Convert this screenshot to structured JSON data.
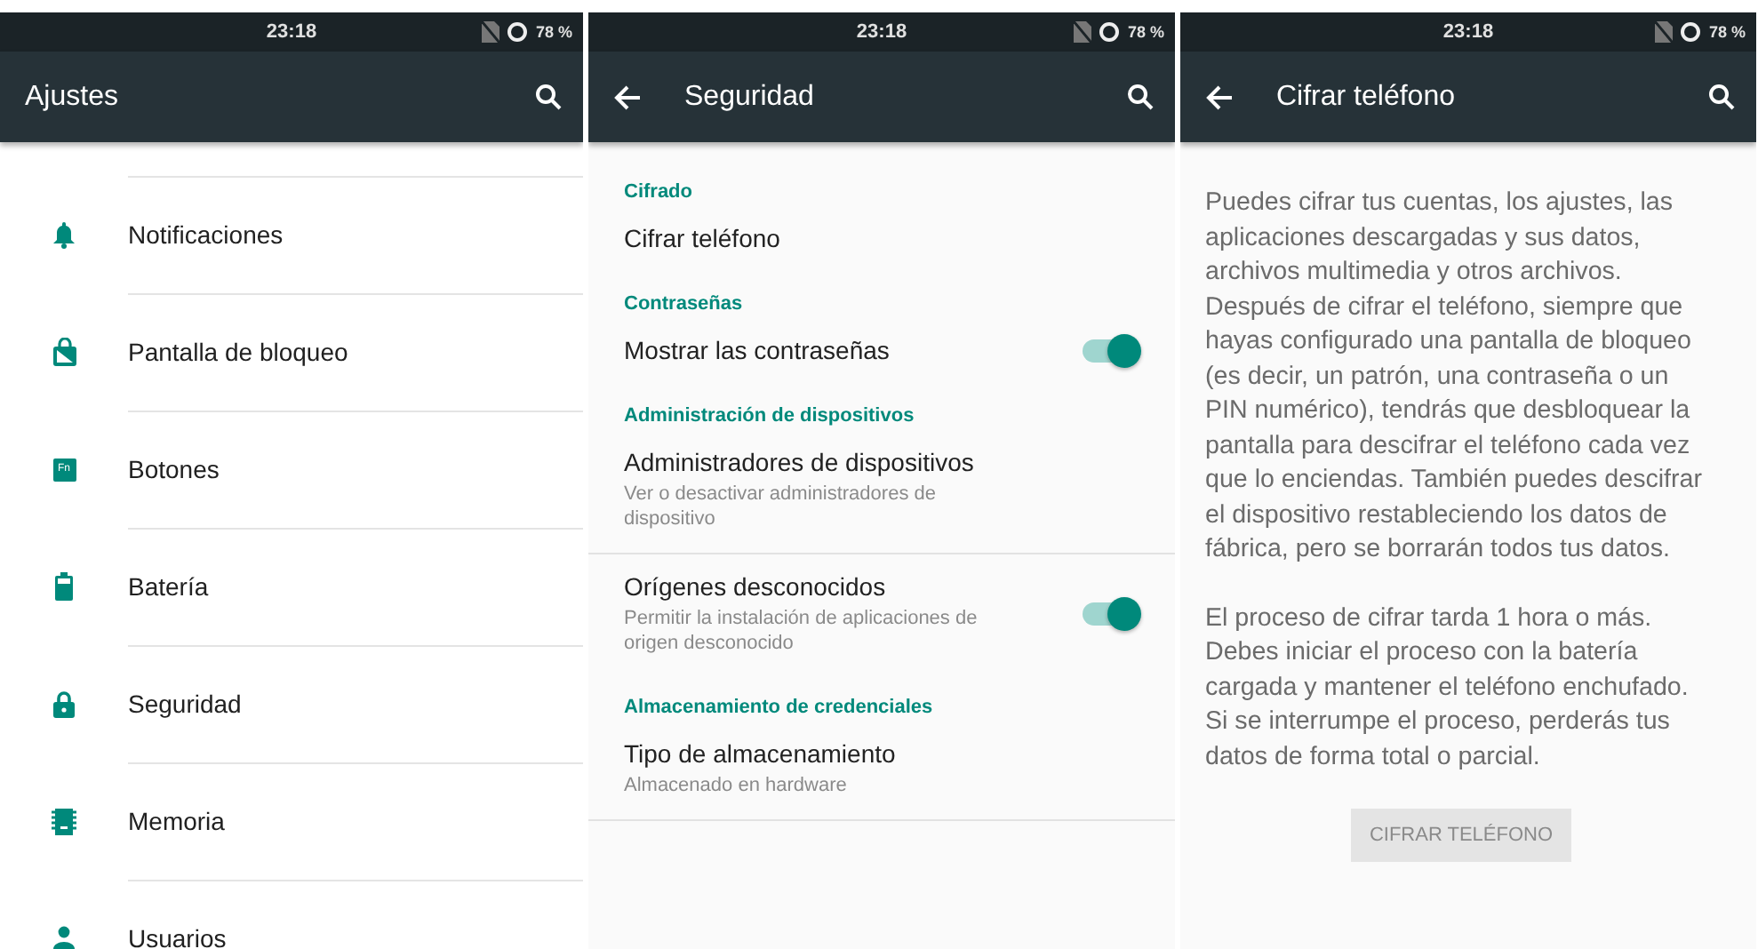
{
  "settings_screen": {
    "status_bar": {
      "time": "23:18",
      "battery": "78 %"
    },
    "app_bar": {
      "title": "Ajustes",
      "back_button": false
    },
    "items": [
      {
        "kind": "bell",
        "label": "Notificaciones"
      },
      {
        "kind": "lockscreen",
        "label": "Pantalla de bloqueo"
      },
      {
        "kind": "fn",
        "label": "Botones",
        "icon_text": "Fn"
      },
      {
        "kind": "battery",
        "label": "Batería"
      },
      {
        "kind": "lock",
        "label": "Seguridad"
      },
      {
        "kind": "memory",
        "label": "Memoria"
      },
      {
        "kind": "user",
        "label": "Usuarios"
      }
    ]
  },
  "security_screen": {
    "status_bar": {
      "time": "23:18",
      "battery": "78 %"
    },
    "app_bar": {
      "title": "Seguridad",
      "back_button": true
    },
    "sections": [
      {
        "header": "Cifrado",
        "items": [
          {
            "title": "Cifrar teléfono"
          }
        ]
      },
      {
        "header": "Contraseñas",
        "items": [
          {
            "title": "Mostrar las contraseñas",
            "kind": "switch",
            "on": true
          }
        ]
      },
      {
        "header": "Administración de dispositivos",
        "items": [
          {
            "title": "Administradores de dispositivos",
            "summary": "Ver o desactivar administradores de dispositivo",
            "divider": true
          },
          {
            "title": "Orígenes desconocidos",
            "summary": "Permitir la instalación de aplicaciones de origen desconocido",
            "kind": "switch",
            "on": true
          }
        ]
      },
      {
        "header": "Almacenamiento de credenciales",
        "items": [
          {
            "title": "Tipo de almacenamiento",
            "summary": "Almacenado en hardware",
            "divider": true
          }
        ]
      }
    ]
  },
  "encrypt_screen": {
    "status_bar": {
      "time": "23:18",
      "battery": "78 %"
    },
    "app_bar": {
      "title": "Cifrar teléfono",
      "back_button": true
    },
    "paragraphs": [
      "Puedes cifrar tus cuentas, los ajustes, las aplicaciones descargadas y sus datos, archivos multimedia y otros archivos. Después de cifrar el teléfono, siempre que hayas configurado una pantalla de bloqueo (es decir, un patrón, una contraseña o un PIN numérico), tendrás que desbloquear la pantalla para descifrar el teléfono cada vez que lo enciendas. También puedes descifrar el dispositivo restableciendo los datos de fábrica, pero se borrarán todos tus datos.",
      "El proceso de cifrar tarda 1 hora o más. Debes iniciar el proceso con la batería cargada y mantener el teléfono enchufado. Si se interrumpe el proceso, perderás tus datos de forma total o parcial."
    ],
    "button": {
      "label": "CIFRAR TELÉFONO",
      "disabled": true
    }
  }
}
